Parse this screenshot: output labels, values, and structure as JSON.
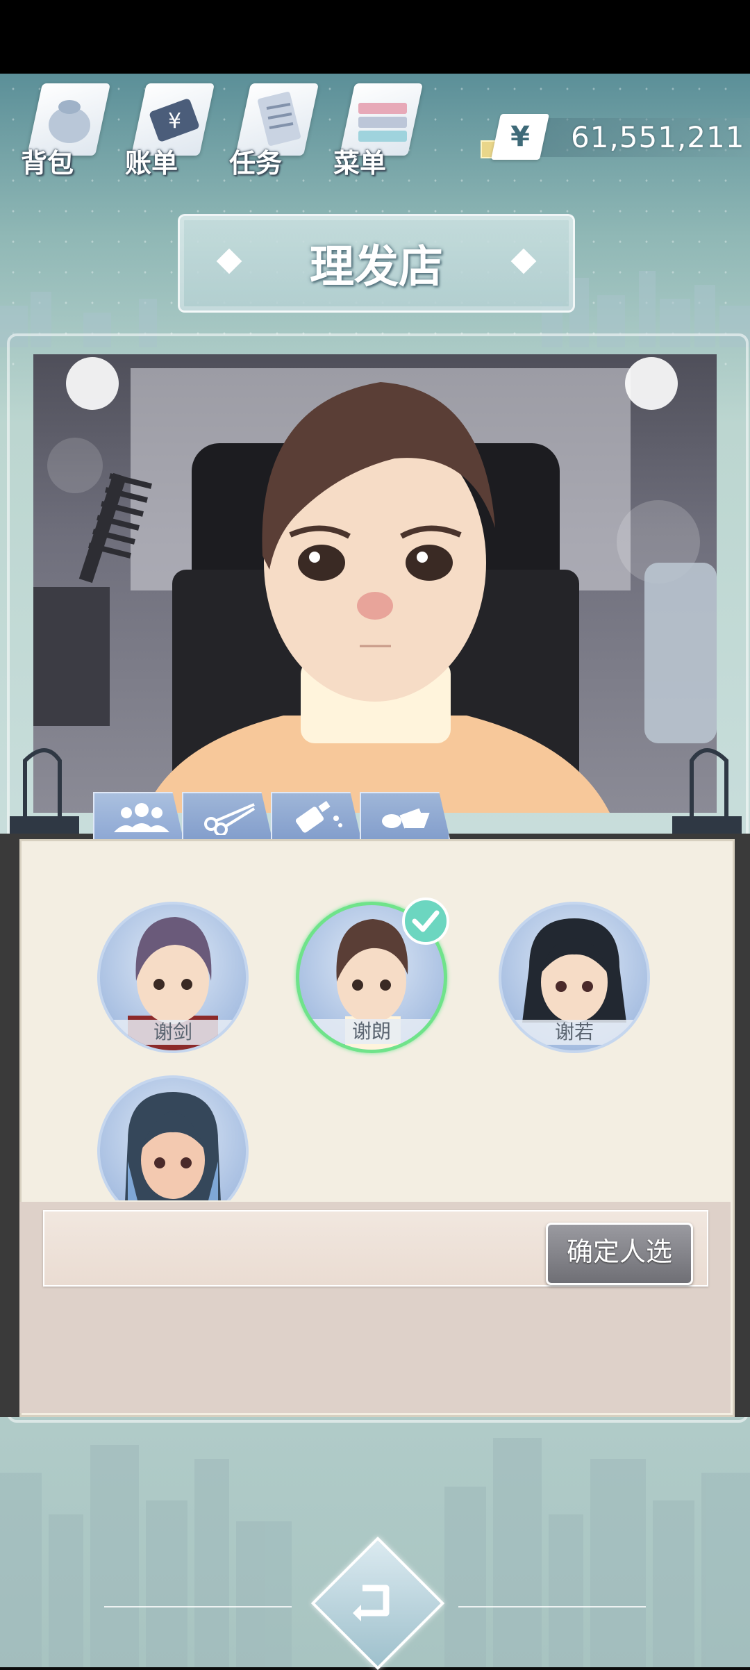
{
  "app": {
    "title": "理发店"
  },
  "top_menu": {
    "items": [
      {
        "label": "背包",
        "icon": "backpack-icon"
      },
      {
        "label": "账单",
        "icon": "bill-icon"
      },
      {
        "label": "任务",
        "icon": "task-icon"
      },
      {
        "label": "菜单",
        "icon": "menu-icon"
      }
    ]
  },
  "currency": {
    "symbol": "¥",
    "amount": "61,551,211"
  },
  "tabs": [
    {
      "name": "characters-tab",
      "icon": "people-icon",
      "active": true
    },
    {
      "name": "haircut-tab",
      "icon": "scissors-icon",
      "active": false
    },
    {
      "name": "dye-tab",
      "icon": "dye-bottle-icon",
      "active": false
    },
    {
      "name": "accessory-tab",
      "icon": "accessory-icon",
      "active": false
    }
  ],
  "characters": [
    {
      "name": "谢剑",
      "selected": false
    },
    {
      "name": "谢朗",
      "selected": true
    },
    {
      "name": "谢若",
      "selected": false
    },
    {
      "name": "",
      "selected": false
    }
  ],
  "confirm": {
    "label": "确定人选"
  },
  "colors": {
    "accent_tab": "#8ea8d4",
    "selected_ring": "#6fe38a",
    "check_badge": "#6cd6c0",
    "panel_bg": "#f3eee2"
  }
}
